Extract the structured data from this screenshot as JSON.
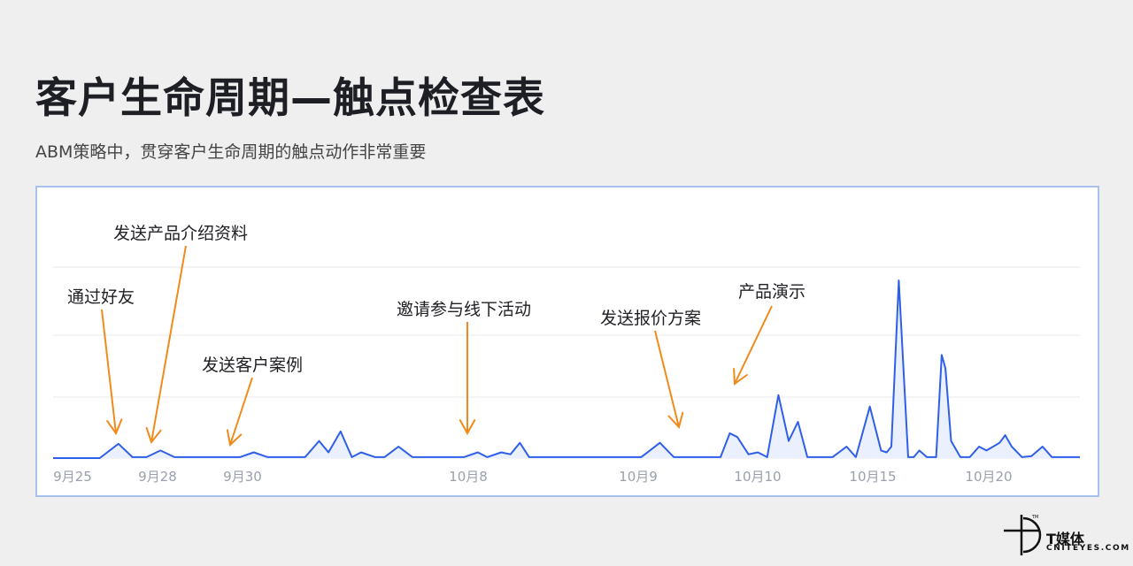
{
  "header": {
    "title": "客户生命周期—触点检查表",
    "subtitle": "ABM策略中，贯穿客户生命周期的触点动作非常重要"
  },
  "colors": {
    "line": "#2f5fe8",
    "fill": "#eaf0fd",
    "arrow": "#f28a1a",
    "grid": "#e8e8ec",
    "tick": "#9aa0ad"
  },
  "logo": {
    "name": "T媒体",
    "sub": "CNITEYES.COM"
  },
  "chart_data": {
    "type": "area",
    "x": [
      "9月25",
      "",
      "",
      "",
      "",
      "9月28",
      "",
      "",
      "",
      "9月30",
      "",
      "",
      "",
      "",
      "",
      "",
      "",
      "",
      "",
      "",
      "",
      "",
      "",
      "",
      "",
      "",
      "",
      "",
      "",
      "",
      "",
      "",
      "",
      "",
      "",
      "",
      "",
      "",
      "10月8",
      "",
      "",
      "",
      "",
      "",
      "",
      "",
      "",
      "",
      "",
      "",
      "",
      "",
      "",
      "",
      "",
      "",
      "",
      "",
      "",
      "",
      "",
      "",
      "",
      "",
      "",
      "",
      "",
      "10月9",
      "",
      "",
      "",
      "",
      "",
      "",
      "",
      "",
      "",
      "",
      "",
      "",
      "",
      "",
      "",
      "",
      "",
      "",
      "",
      "",
      "",
      "",
      "",
      "",
      "",
      "",
      "",
      "",
      "10月10",
      "",
      "",
      "",
      "",
      "",
      "",
      "",
      "",
      "",
      "",
      "",
      "",
      "",
      "",
      "",
      "",
      "",
      "",
      "",
      "",
      "",
      "",
      "",
      "",
      "",
      "",
      "",
      "",
      "10月15",
      "",
      "",
      "",
      "",
      "",
      "",
      "",
      "",
      "",
      "",
      "",
      "",
      "",
      "",
      "",
      "",
      "",
      "",
      "",
      "",
      "",
      "",
      "",
      "",
      "",
      "",
      "",
      "",
      "10月20",
      "",
      "",
      "",
      "",
      "",
      "",
      ""
    ],
    "y": [
      0,
      0,
      0,
      0,
      0,
      7.5,
      0,
      0,
      4,
      0,
      0,
      0,
      0,
      0,
      0,
      0,
      3,
      0,
      0,
      0,
      0,
      9,
      2,
      14,
      1,
      3,
      1,
      1,
      6,
      1,
      1,
      1,
      1,
      1,
      1,
      1,
      3,
      1,
      4,
      2,
      8,
      1,
      1,
      1,
      1,
      1,
      1,
      1,
      1,
      1,
      1,
      1,
      1,
      1,
      1,
      1,
      1,
      1,
      1,
      1,
      1,
      1,
      1,
      1,
      1,
      1,
      1,
      1,
      1,
      1,
      1,
      1,
      1,
      1,
      1,
      1,
      1,
      1,
      1,
      1,
      1,
      1,
      1,
      1,
      1,
      1,
      1,
      1,
      1,
      1,
      1,
      1,
      1,
      1,
      1,
      1,
      1,
      1,
      1,
      1,
      1,
      1,
      1,
      1,
      1,
      1,
      1,
      1,
      1,
      1,
      1,
      1,
      1,
      1,
      1,
      1,
      1,
      1,
      1,
      1,
      1,
      1,
      1
    ],
    "series": [
      {
        "points": [
          [
            0,
            0
          ],
          [
            5,
            0
          ],
          [
            7,
            7.5
          ],
          [
            8.5,
            0.5
          ],
          [
            10,
            0.5
          ],
          [
            11.5,
            4
          ],
          [
            13,
            0.5
          ],
          [
            15,
            0.5
          ],
          [
            17,
            0.5
          ],
          [
            20,
            0.5
          ],
          [
            21.5,
            3
          ],
          [
            23,
            0.5
          ],
          [
            25,
            0.5
          ],
          [
            27,
            0.5
          ],
          [
            28.5,
            9
          ],
          [
            29.5,
            3
          ],
          [
            30.8,
            14
          ],
          [
            32,
            0.5
          ],
          [
            33,
            3
          ],
          [
            34.5,
            0.5
          ],
          [
            35.5,
            0.5
          ],
          [
            37,
            6
          ],
          [
            38.5,
            0.5
          ],
          [
            40,
            0.5
          ],
          [
            42,
            0.5
          ],
          [
            44,
            0.5
          ],
          [
            45.5,
            3
          ],
          [
            46.5,
            0.5
          ],
          [
            48,
            3
          ],
          [
            49,
            2
          ],
          [
            50,
            8
          ],
          [
            51,
            0.5
          ],
          [
            53,
            0.5
          ],
          [
            56,
            0.5
          ],
          [
            60,
            0.5
          ],
          [
            63,
            0.5
          ],
          [
            65,
            8
          ],
          [
            66.5,
            0.5
          ],
          [
            68,
            0.5
          ],
          [
            70,
            0.5
          ],
          [
            71.5,
            0.5
          ],
          [
            72.5,
            13
          ],
          [
            73.3,
            11
          ],
          [
            74.5,
            2
          ],
          [
            75.5,
            3
          ],
          [
            76.5,
            0.5
          ],
          [
            77.7,
            33
          ],
          [
            78.8,
            9
          ],
          [
            79.8,
            19
          ],
          [
            80.8,
            0.5
          ],
          [
            82,
            0.5
          ],
          [
            83.5,
            0.5
          ],
          [
            85,
            6
          ],
          [
            86,
            0.5
          ],
          [
            87.5,
            27
          ],
          [
            88.7,
            4
          ],
          [
            89.3,
            3
          ],
          [
            89.8,
            6
          ],
          [
            90.6,
            93
          ],
          [
            91.6,
            0.5
          ],
          [
            92.2,
            0.5
          ],
          [
            92.8,
            4
          ],
          [
            93.6,
            0.5
          ],
          [
            94.6,
            0.5
          ],
          [
            95.2,
            54
          ],
          [
            95.6,
            47
          ],
          [
            96.2,
            9
          ],
          [
            97.2,
            0.5
          ],
          [
            98.2,
            0.5
          ],
          [
            99.2,
            6
          ],
          [
            100,
            4
          ],
          [
            101.4,
            8
          ],
          [
            102,
            12
          ],
          [
            102.7,
            6
          ],
          [
            103.8,
            0.5
          ],
          [
            104.8,
            1
          ],
          [
            106,
            6
          ],
          [
            107,
            0.5
          ],
          [
            108,
            0.5
          ],
          [
            110,
            0.5
          ]
        ]
      }
    ],
    "annotations": [
      {
        "label": "通过好友"
      },
      {
        "label": "发送产品介绍资料"
      },
      {
        "label": "发送客户案例"
      },
      {
        "label": "邀请参与线下活动"
      },
      {
        "label": "发送报价方案"
      },
      {
        "label": "产品演示"
      }
    ],
    "ticks": [
      "9月25",
      "9月28",
      "9月30",
      "10月8",
      "10月9",
      "10月10",
      "10月15",
      "10月20"
    ],
    "ylim": [
      0,
      100
    ],
    "grid": true
  }
}
